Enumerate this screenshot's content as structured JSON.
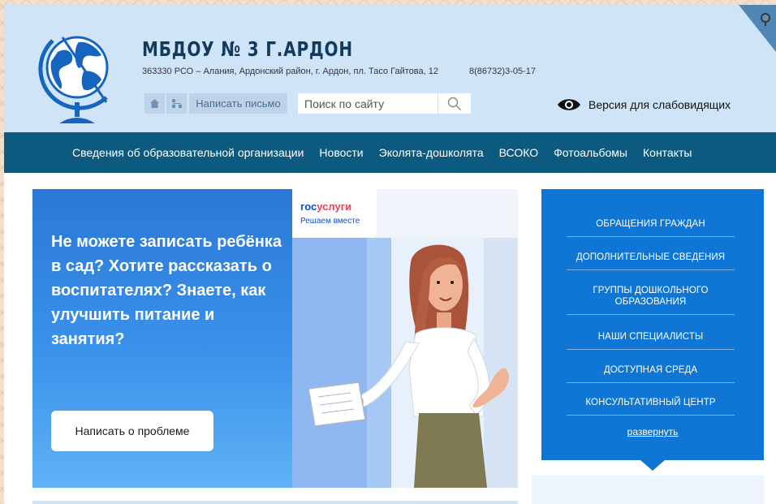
{
  "header": {
    "title": "МБДОУ № 3 Г.АРДОН",
    "address": "363330 РСО – Алания, Ардонский район, г. Ардон, пл. Тасо Гайтова, 12",
    "phone": "8(86732)3-05-17",
    "write_letter": "Написать письмо",
    "search_placeholder": "Поиск по сайту",
    "accessibility_label": "Версия для слабовидящих"
  },
  "nav": {
    "items": [
      "Сведения об образовательной организации",
      "Новости",
      "Эколята-дошколята",
      "ВСОКО",
      "Фотоальбомы",
      "Контакты"
    ]
  },
  "banner": {
    "headline": "Не можете записать ребёнка в сад? Хотите рассказать о воспитателях? Знаете, как улучшить питание и занятия?",
    "button_label": "Написать о проблеме",
    "logo_part1": "гос",
    "logo_part2": "услуги",
    "tagline": "Решаем вместе"
  },
  "sidebar": {
    "items": [
      "Обращения граждан",
      "Дополнительные сведения",
      "Группы дошкольного образования",
      "Наши специалисты",
      "Доступная среда",
      "Консультативный центр"
    ],
    "expand_label": "развернуть"
  },
  "colors": {
    "header_bg": "#cfe4f7",
    "nav_bg": "#0d5a80",
    "sidebar_bg": "#1076d6",
    "gosuslugi_blue": "#0d4cd3",
    "gosuslugi_red": "#ee3f58"
  },
  "icons": {
    "home": "home-icon",
    "sitemap": "sitemap-icon",
    "search": "search-icon",
    "eye": "eye-icon",
    "corner": "globe-corner-icon",
    "logo": "globe-logo-icon"
  }
}
